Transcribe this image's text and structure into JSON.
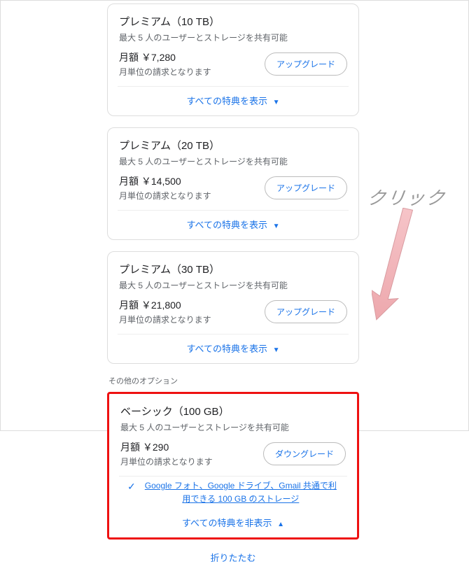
{
  "plans": [
    {
      "title": "プレミアム（10 TB）",
      "sub": "最大 5 人のユーザーとストレージを共有可能",
      "price": "月額 ￥7,280",
      "bill": "月単位の請求となります",
      "action": "アップグレード",
      "toggle": "すべての特典を表示"
    },
    {
      "title": "プレミアム（20 TB）",
      "sub": "最大 5 人のユーザーとストレージを共有可能",
      "price": "月額 ￥14,500",
      "bill": "月単位の請求となります",
      "action": "アップグレード",
      "toggle": "すべての特典を表示"
    },
    {
      "title": "プレミアム（30 TB）",
      "sub": "最大 5 人のユーザーとストレージを共有可能",
      "price": "月額 ￥21,800",
      "bill": "月単位の請求となります",
      "action": "アップグレード",
      "toggle": "すべての特典を表示"
    }
  ],
  "other_options_label": "その他のオプション",
  "basic": {
    "title": "ベーシック（100 GB）",
    "sub": "最大 5 人のユーザーとストレージを共有可能",
    "price": "月額 ￥290",
    "bill": "月単位の請求となります",
    "action": "ダウングレード",
    "benefit_link": "Google フォト、Google ドライブ、Gmail 共通で利用できる 100 GB のストレージ",
    "toggle": "すべての特典を非表示"
  },
  "collapse": "折りたたむ",
  "annotation": "クリック"
}
